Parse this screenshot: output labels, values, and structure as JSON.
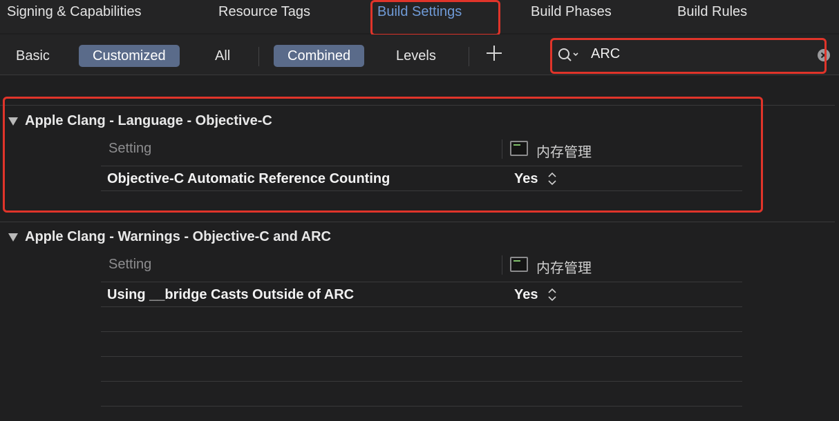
{
  "tabs": [
    {
      "label": "Signing & Capabilities"
    },
    {
      "label": "Resource Tags"
    },
    {
      "label": "Build Settings"
    },
    {
      "label": "Build Phases"
    },
    {
      "label": "Build Rules"
    }
  ],
  "filter": {
    "basic": "Basic",
    "customized": "Customized",
    "all": "All",
    "combined": "Combined",
    "levels": "Levels"
  },
  "search": {
    "value": "ARC"
  },
  "sections": [
    {
      "title": "Apple Clang - Language - Objective-C",
      "column_header": "Setting",
      "target": "内存管理",
      "rows": [
        {
          "name": "Objective-C Automatic Reference Counting",
          "value": "Yes"
        }
      ]
    },
    {
      "title": "Apple Clang - Warnings - Objective-C and ARC",
      "column_header": "Setting",
      "target": "内存管理",
      "rows": [
        {
          "name": "Using __bridge Casts Outside of ARC",
          "value": "Yes"
        }
      ]
    }
  ],
  "colors": {
    "background": "#1f1f20",
    "active_tab": "#6f9ad6",
    "selected_segment": "#5a6b8a",
    "highlight": "#e0342a"
  }
}
